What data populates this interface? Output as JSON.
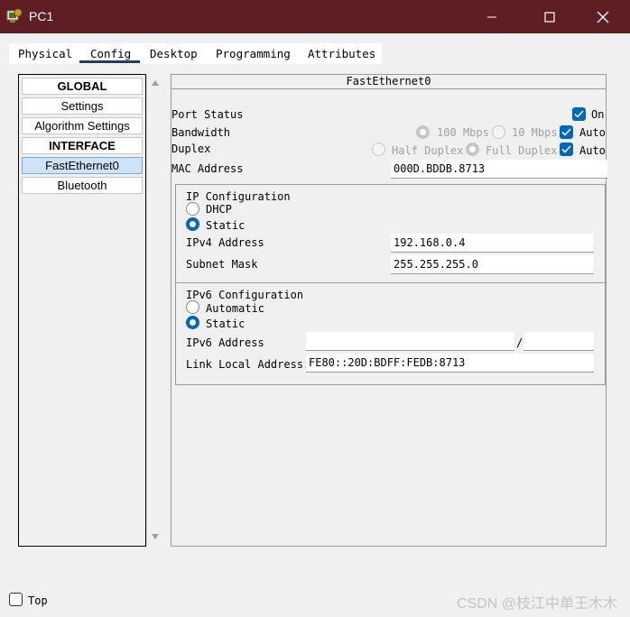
{
  "window": {
    "title": "PC1"
  },
  "tabs": [
    {
      "label": "Physical"
    },
    {
      "label": "Config",
      "active": true
    },
    {
      "label": "Desktop"
    },
    {
      "label": "Programming"
    },
    {
      "label": "Attributes"
    }
  ],
  "left_list": {
    "items": [
      {
        "label": "GLOBAL",
        "kind": "header"
      },
      {
        "label": "Settings"
      },
      {
        "label": "Algorithm Settings"
      },
      {
        "label": "INTERFACE",
        "kind": "header"
      },
      {
        "label": "FastEthernet0",
        "selected": true
      },
      {
        "label": "Bluetooth"
      }
    ]
  },
  "interface": {
    "title": "FastEthernet0",
    "port_status": {
      "label": "Port Status",
      "on_label": "On",
      "on": true
    },
    "bandwidth": {
      "label": "Bandwidth",
      "opt_100": "100 Mbps",
      "opt_10": "10 Mbps",
      "auto_label": "Auto",
      "auto": true
    },
    "duplex": {
      "label": "Duplex",
      "opt_half": "Half Duplex",
      "opt_full": "Full Duplex",
      "auto_label": "Auto",
      "auto": true
    },
    "mac": {
      "label": "MAC Address",
      "value": "000D.BDDB.8713"
    },
    "ip_config": {
      "title": "IP Configuration",
      "dhcp_label": "DHCP",
      "static_label": "Static",
      "mode": "Static",
      "ipv4_label": "IPv4 Address",
      "ipv4_value": "192.168.0.4",
      "mask_label": "Subnet Mask",
      "mask_value": "255.255.255.0"
    },
    "ipv6_config": {
      "title": "IPv6 Configuration",
      "automatic_label": "Automatic",
      "static_label": "Static",
      "mode": "Static",
      "ipv6_label": "IPv6 Address",
      "ipv6_value": "",
      "prefix_separator": "/",
      "prefix_value": "",
      "link_local_label": "Link Local Address:",
      "link_local_value": "FE80::20D:BDFF:FEDB:8713"
    }
  },
  "footer": {
    "top_label": "Top",
    "top_checked": false
  },
  "watermark": "CSDN @枝江中单王木木",
  "colors": {
    "titlebar": "#5e1e24",
    "accent": "#0067c0",
    "selected_item": "#cfe3f8"
  }
}
